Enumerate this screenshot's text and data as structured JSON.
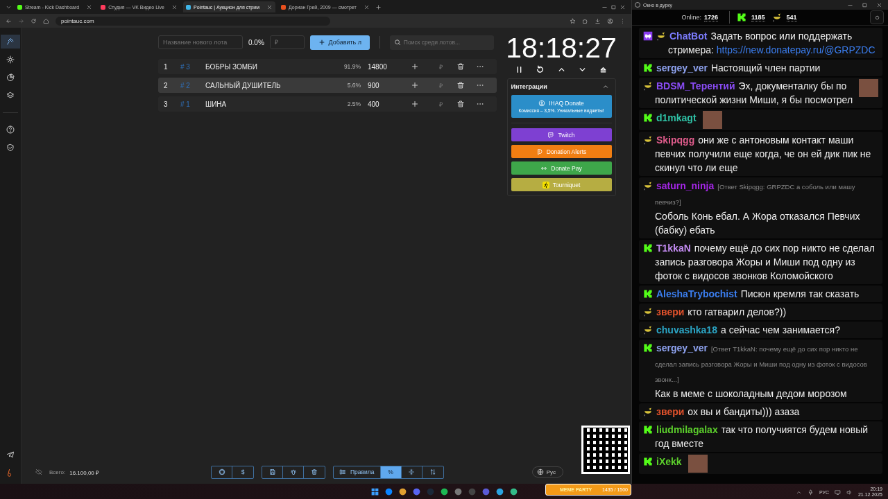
{
  "browser": {
    "tabs": [
      {
        "title": "Stream - Kick Dashboard",
        "color": "#53fc18",
        "selected": false
      },
      {
        "title": "Студия — VK Видео Live",
        "color": "#ff3b5c",
        "selected": false
      },
      {
        "title": "Pointauc | Аукцион для стрим",
        "color": "#3fb6e8",
        "selected": true
      },
      {
        "title": "Дориан Грей, 2009 — смотрет",
        "color": "#e8501e",
        "selected": false
      }
    ],
    "url": "pointauc.com"
  },
  "sidebar": {
    "items": [
      {
        "selected": true
      },
      {
        "selected": false
      },
      {
        "selected": false
      },
      {
        "selected": false
      },
      {
        "selected": false
      },
      {
        "selected": false
      }
    ]
  },
  "auction": {
    "new_lot": {
      "placeholder": "Название нового лота"
    },
    "new_lot_percent": "0.0%",
    "amount": {
      "placeholder": "₽"
    },
    "add_button": "Добавить л",
    "search": {
      "placeholder": "Поиск среди лотов..."
    },
    "lots": [
      {
        "rank": "1",
        "id": "# 3",
        "name": "БОБРЫ ЗОМБИ",
        "percent": "91.9%",
        "amount": "14800",
        "currency": "₽",
        "highlighted": false
      },
      {
        "rank": "2",
        "id": "# 2",
        "name": "САЛЬНЫЙ ДУШИТЕЛЬ",
        "percent": "5.6%",
        "amount": "900",
        "currency": "₽",
        "highlighted": true
      },
      {
        "rank": "3",
        "id": "# 1",
        "name": "ШИНА",
        "percent": "2.5%",
        "amount": "400",
        "currency": "₽",
        "highlighted": false
      }
    ]
  },
  "timer": {
    "time": "18:18:27"
  },
  "integrations": {
    "title": "Интеграции",
    "expanded": true,
    "items": [
      {
        "kind": "ihaq",
        "label": "IHAQ Donate",
        "subtitle": "Комиссия – 3,5%. Уникальные виджеты!",
        "color": "#2b8ec9"
      },
      {
        "kind": "twitch",
        "label": "Twitch",
        "color": "#7e40d2"
      },
      {
        "kind": "alerts",
        "label": "Donation Alerts",
        "color": "#f17e12"
      },
      {
        "kind": "donatepay",
        "label": "Donate Pay",
        "color": "#3ea64a"
      },
      {
        "kind": "tourniquet",
        "label": "Tourniquet",
        "color": "#b6ad42"
      }
    ]
  },
  "footer": {
    "total_label": "Всего:",
    "total_value": "16.100,00 ₽",
    "language": "Рус",
    "toolbar": [
      {
        "items": [
          {
            "kind": "github"
          },
          {
            "kind": "text",
            "label": "$"
          }
        ]
      },
      {
        "items": [
          {
            "kind": "save"
          },
          {
            "kind": "bug"
          },
          {
            "kind": "trash"
          }
        ]
      },
      {
        "items": [
          {
            "kind": "list",
            "label": "Правила",
            "selected": false
          },
          {
            "kind": "text",
            "label": "%",
            "selected": true
          },
          {
            "kind": "split",
            "selected": false
          },
          {
            "kind": "sort",
            "selected": false
          }
        ]
      }
    ]
  },
  "overlay": {
    "widget_title": "MEME PARTY",
    "widget_count": "1435 / 1500"
  },
  "chat": {
    "window_title": "Окно в дурку",
    "online_label": "Online:",
    "online_count": "1726",
    "kick_count": "1185",
    "vk_count": "541",
    "messages": [
      {
        "kind": "bot",
        "user": "ChatBot",
        "color": "#7d7dff",
        "text": "Задать вопрос или поддержать стримера:",
        "link": "https://new.donatepay.ru/@GRPZDC"
      },
      {
        "kind": "kick",
        "user": "sergey_ver",
        "color": "#8ea2ef",
        "text": "Настоящий член партии"
      },
      {
        "kind": "vk",
        "user": "BDSM_Терентий",
        "color": "#8a4cf5",
        "text": "Эх, документалку бы по политической жизни Миши, я бы посмотрел",
        "emote": true
      },
      {
        "kind": "kick",
        "user": "d1mkagt",
        "color": "#2fc2a6",
        "emote": true
      },
      {
        "kind": "vk",
        "user": "Skipqgg",
        "color": "#e05c8c",
        "text": "они же с антоновым контакт маши певчих получили еще когда, че он ей дик пик не скинул что ли еще"
      },
      {
        "kind": "vk",
        "user": "saturn_ninja",
        "color": "#a526e8",
        "reply": "[Ответ Skipqgg: GRPZDC а соболь или машу певчиз?]",
        "text": "Соболь Конь ебал. А Жора отказался Певчих (бабку) ебать"
      },
      {
        "kind": "kick",
        "user": "T1kkaN",
        "color": "#c48cf2",
        "text": "почему ещё до сих пор никто не сделал запись разговора Жоры и Миши под одну из фоток с видосов звонков Коломойского"
      },
      {
        "kind": "kick",
        "user": "AleshaTrybochist",
        "color": "#3b7ef0",
        "text": "Писюн кремля так сказать"
      },
      {
        "kind": "vk",
        "user": "звери",
        "color": "#e2522c",
        "text": "кто гатварил делов?))"
      },
      {
        "kind": "vk",
        "user": "chuvashka18",
        "color": "#2ba6c6",
        "text": "а сейчас чем занимается?"
      },
      {
        "kind": "kick",
        "user": "sergey_ver",
        "color": "#8ea2ef",
        "reply": "[Ответ T1kkaN: почему ещё до сих пор никто не сделал запись разговора Жоры и Миши под одну из фоток с видосов звонк...]",
        "text": "Как в меме с шоколадным дедом морозом"
      },
      {
        "kind": "vk",
        "user": "звери",
        "color": "#e2522c",
        "text": "ох вы и бандиты))) азаза"
      },
      {
        "kind": "kick",
        "user": "liudmilagalax",
        "color": "#5ccf2c",
        "text": "так что получиятся будем новый год вместе"
      },
      {
        "kind": "kick",
        "user": "iXekk",
        "color": "#5ccf2c",
        "emote": true
      }
    ]
  },
  "taskbar": {
    "language": "РУС",
    "time": "20:19",
    "date": "21.12.2025"
  }
}
